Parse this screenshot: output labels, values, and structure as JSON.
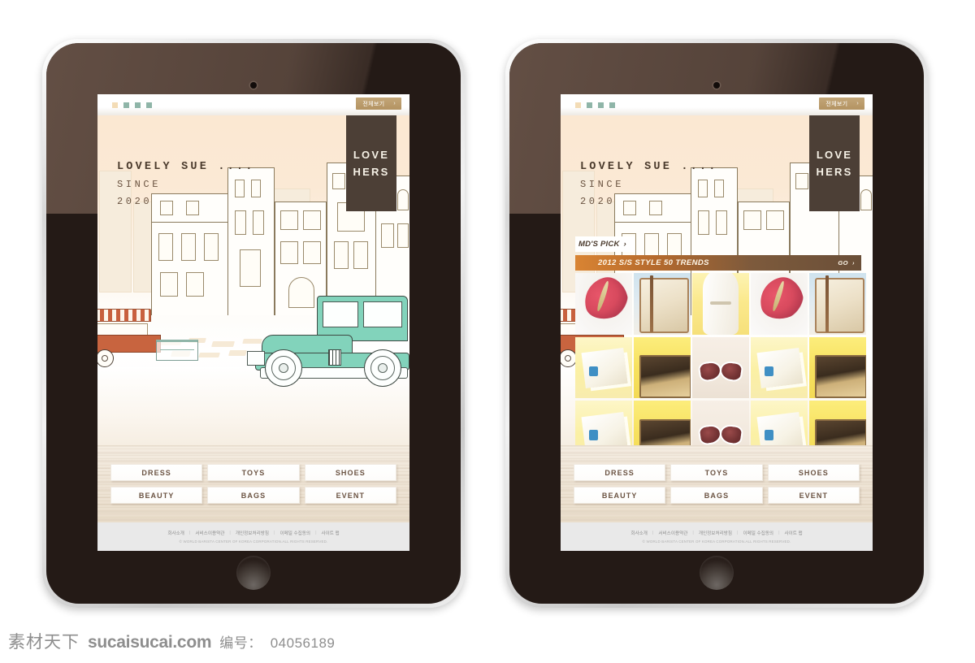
{
  "watermark": {
    "site_cn": "素材天下",
    "site_url": "sucaisucai.com",
    "number_label": "编号：",
    "number": "04056189"
  },
  "site": {
    "topbar": {
      "view_all_label": "전체보기",
      "view_all_chevron": "›",
      "dots": [
        "dot-cream",
        "dot-green",
        "dot-green",
        "dot-green"
      ]
    },
    "hero": {
      "headline_1": "LOVELY SUE ....",
      "headline_2": "SINCE",
      "headline_3": "2020",
      "badge_line_1": "LOVE",
      "badge_line_2": "HERS"
    },
    "mdpick": {
      "label": "MD'S PICK",
      "label_chevron": "›",
      "banner_title": "2012 S/S STYLE 50 TRENDS",
      "go_label": "GO",
      "go_chevron": "›"
    },
    "photo_grid": {
      "rows": [
        [
          "flower",
          "case",
          "dress",
          "flower",
          "case"
        ],
        [
          "cards",
          "open",
          "sun",
          "cards",
          "open"
        ],
        [
          "cards",
          "open",
          "sun",
          "cards",
          "open"
        ]
      ]
    },
    "nav": {
      "row_1": [
        "DRESS",
        "TOYS",
        "SHOES"
      ],
      "row_2": [
        "BEAUTY",
        "BAGS",
        "EVENT"
      ]
    },
    "footer": {
      "links": [
        "회사소개",
        "서비스이용약관",
        "개인정보처리방침",
        "이메일 수집동의",
        "사이트 맵"
      ],
      "separator": "|",
      "copyright": "© WORLD BARISTA CENTER OF KOREA CORPORATION.ALL RIGHTS RESERVED."
    }
  },
  "colors": {
    "hero_bg": "#fbe8d2",
    "badge_brown": "#4c3f36",
    "accent_tan": "#b39362",
    "banner_orange": "#d98433",
    "banner_brown": "#6a4f38",
    "nav_text": "#6b5342",
    "car_mint": "#82d3bb",
    "bezel": "#241a16"
  }
}
